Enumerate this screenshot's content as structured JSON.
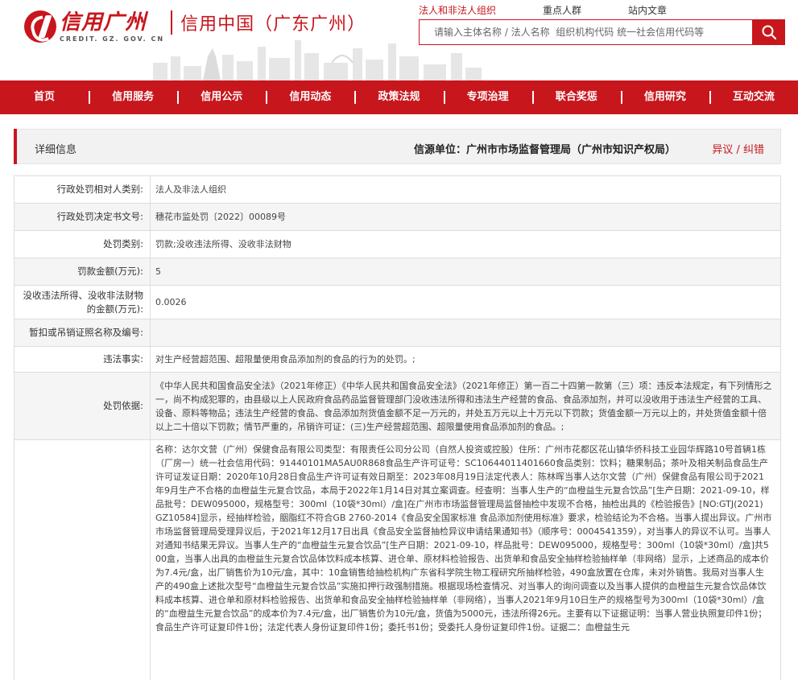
{
  "header": {
    "logo_cn": "信用广州",
    "logo_en": "CREDIT. GZ. GOV. CN",
    "logo_sub": "信用中国（广东广州）",
    "search_tabs": [
      "法人和非法人组织",
      "重点人群",
      "站内文章"
    ],
    "search_placeholder": "请输入主体名称 / 法人名称  组织机构代码 统一社会信用代码等"
  },
  "nav": [
    "首页",
    "信用服务",
    "信用公示",
    "信用动态",
    "政策法规",
    "专项治理",
    "联合奖惩",
    "信用研究",
    "互动交流"
  ],
  "detail": {
    "title": "详细信息",
    "source": "信源单位：广州市市场监督管理局（广州市知识产权局）",
    "objection": "异议 / 纠错"
  },
  "rows": [
    {
      "label": "行政处罚相对人类别:",
      "value": "法人及非法人组织"
    },
    {
      "label": "行政处罚决定书文号:",
      "value": "穗花市监处罚〔2022〕00089号"
    },
    {
      "label": "处罚类别:",
      "value": "罚款;没收违法所得、没收非法财物"
    },
    {
      "label": "罚款金额(万元):",
      "value": "5"
    },
    {
      "label": "没收违法所得、没收非法财物的金额(万元):",
      "value": "0.0026"
    },
    {
      "label": "暂扣或吊销证照名称及编号:",
      "value": ""
    },
    {
      "label": "违法事实:",
      "value": "对生产经营超范围、超限量使用食品添加剂的食品的行为的处罚。;"
    },
    {
      "label": "处罚依据:",
      "value": "《中华人民共和国食品安全法》（2021年修正）《中华人民共和国食品安全法》（2021年修正）第一百二十四第一款第（三）项：违反本法规定，有下列情形之一，尚不构成犯罪的，由县级以上人民政府食品药品监督管理部门没收违法所得和违法生产经营的食品、食品添加剂，并可以没收用于违法生产经营的工具、设备、原料等物品；违法生产经营的食品、食品添加剂货值金额不足一万元的，并处五万元以上十万元以下罚款；货值金额一万元以上的，并处货值金额十倍以上二十倍以下罚款；情节严重的，吊销许可证：(三)生产经营超范围、超限量使用食品添加剂的食品。;"
    },
    {
      "label": "",
      "value": "名称：达尔文营（广州）保健食品有限公司类型：有限责任公司分公司（自然人投资或控股）住所：广州市花都区花山镇华侨科技工业园华辉路10号首辆1栋（厂房一）统一社会信用代码：91440101MA5AU0R868食品生产许可证号：SC10644011401660食品类别：饮料；糖果制品；茶叶及相关制品食品生产许可证发证日期：2020年10月28日食品生产许可证有效日期至：2023年08月19日法定代表人：陈林晖当事人达尔文营（广州）保健食品有限公司于2021年9月生产不合格的血橙益生元复合饮品，本局于2022年1月14日对其立案调查。经查明：当事人生产的“血橙益生元复合饮品”[生产日期：2021-09-10，样品批号：DEW095000，规格型号：300ml（10袋*30ml）/盒]在广州市市场监督管理局监督抽检中发现不合格，抽检出具的《检验报告》[NO:GTJ(2021) GZ10584]显示，经抽样检验，胭脂红不符合GB 2760-2014《食品安全国家标准 食品添加剂使用标准》要求，检验结论为不合格。当事人提出异议。广州市市场监督管理局受理异议后，于2021年12月17日出具《食品安全监督抽检异议申请结果通知书》（顺序号：0004541359），对当事人的异议不认可。当事人对通知书结果无异议。当事人生产的“血橙益生元复合饮品”[生产日期：2021-09-10，样品批号：DEW095000，规格型号：300ml（10袋*30ml）/盒]共500盒，当事人出具的血橙益生元复合饮品体饮料成本核算、进仓单、原材料检验报告、出货单和食品安全抽样检验抽样单（非网络）显示，上述商品的成本价为7.4元/盒，出厂销售价为10元/盒，其中：10盒销售给抽检机构广东省科学院生物工程研究所抽样检验，490盒放置在仓库，未对外销售。我局对当事人生产的490盒上述批次型号“血橙益生元复合饮品”实施扣押行政强制措施。根据现场检查情况、对当事人的询问调查以及当事人提供的血橙益生元复合饮品体饮料成本核算、进仓单和原材料检验报告、出货单和食品安全抽样检验抽样单（非网络），当事人2021年9月10日生产的规格型号为300ml（10袋*30ml）/盒的“血橙益生元复合饮品”的成本价为7.4元/盒，出厂销售价为10元/盒，货值为5000元，违法所得26元。主要有以下证据证明：当事人营业执照复印件1份；食品生产许可证复印件1份；法定代表人身份证复印件1份；委托书1份；受委托人身份证复印件1份。证据二：血橙益生元"
    }
  ]
}
